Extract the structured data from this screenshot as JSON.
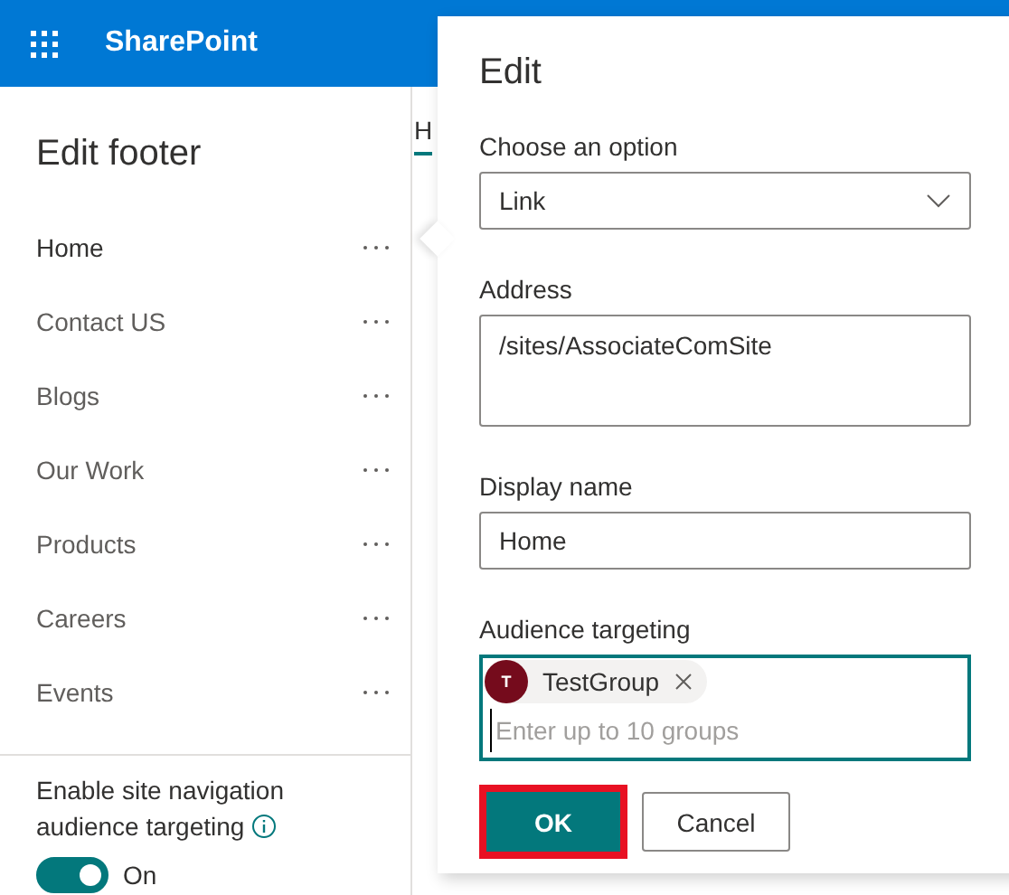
{
  "header": {
    "app_name": "SharePoint"
  },
  "footer_panel": {
    "title": "Edit footer",
    "items": [
      {
        "label": "Home",
        "selected": true
      },
      {
        "label": "Contact US",
        "selected": false
      },
      {
        "label": "Blogs",
        "selected": false
      },
      {
        "label": "Our Work",
        "selected": false
      },
      {
        "label": "Products",
        "selected": false
      },
      {
        "label": "Careers",
        "selected": false
      },
      {
        "label": "Events",
        "selected": false
      }
    ],
    "audience_toggle": {
      "label": "Enable site navigation audience targeting",
      "on": true,
      "state_text": "On"
    }
  },
  "background_tab": {
    "label": "H",
    "selected": true
  },
  "edit_dialog": {
    "title": "Edit",
    "option": {
      "label": "Choose an option",
      "value": "Link"
    },
    "address": {
      "label": "Address",
      "value": "/sites/AssociateComSite"
    },
    "display_name": {
      "label": "Display name",
      "value": "Home"
    },
    "audience": {
      "label": "Audience targeting",
      "groups": [
        {
          "initial": "T",
          "name": "TestGroup",
          "color": "#750b1c"
        }
      ],
      "placeholder": "Enter up to 10 groups"
    },
    "buttons": [
      {
        "label": "OK",
        "kind": "primary",
        "highlighted": true
      },
      {
        "label": "Cancel",
        "kind": "secondary",
        "highlighted": false
      }
    ]
  }
}
